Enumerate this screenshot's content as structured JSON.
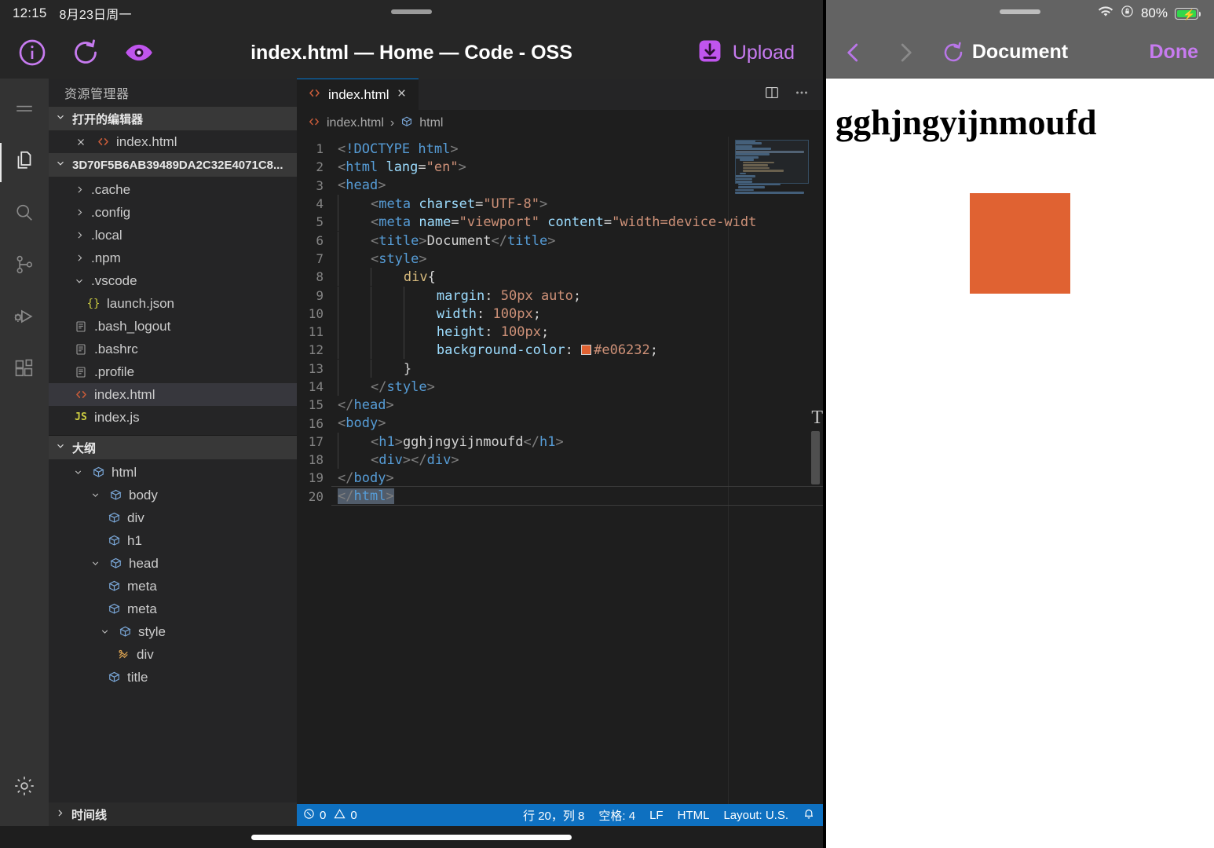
{
  "ios_status_left": {
    "time": "12:15",
    "date": "8月23日周一"
  },
  "ios_status_right": {
    "battery_percent": "80%",
    "wifi_icon": "wifi-icon",
    "lock_icon": "rotation-lock-icon",
    "battery_icon": "battery-charging-icon"
  },
  "app_toolbar": {
    "info_icon": "info-circle-icon",
    "refresh_icon": "refresh-icon",
    "preview_icon": "eye-icon",
    "title": "index.html — Home — Code - OSS",
    "upload_icon": "upload-icon",
    "upload_label": "Upload",
    "accent": "#c77bf0"
  },
  "activity_bar": {
    "items": [
      {
        "name": "menu",
        "icon": "hamburger-menu-icon",
        "active": false
      },
      {
        "name": "explorer",
        "icon": "files-icon",
        "active": true
      },
      {
        "name": "search",
        "icon": "search-icon",
        "active": false
      },
      {
        "name": "source-control",
        "icon": "source-control-icon",
        "active": false
      },
      {
        "name": "run-debug",
        "icon": "run-and-debug-icon",
        "active": false
      },
      {
        "name": "extensions",
        "icon": "extensions-icon",
        "active": false
      }
    ],
    "settings_icon": "gear-icon"
  },
  "sidebar": {
    "title": "资源管理器",
    "open_editors": {
      "label": "打开的编辑器",
      "chevron": "chevron-down-icon",
      "items": [
        {
          "close": "close-icon",
          "icon": "html-file-icon",
          "label": "index.html"
        }
      ]
    },
    "folder": {
      "label": "3D70F5B6AB39489DA2C32E4071C8...",
      "chevron": "chevron-down-icon",
      "items": [
        {
          "chevron": "chevron-right-icon",
          "icon": "",
          "label": ".cache",
          "selected": false
        },
        {
          "chevron": "chevron-right-icon",
          "icon": "",
          "label": ".config",
          "selected": false
        },
        {
          "chevron": "chevron-right-icon",
          "icon": "",
          "label": ".local",
          "selected": false
        },
        {
          "chevron": "chevron-right-icon",
          "icon": "",
          "label": ".npm",
          "selected": false
        },
        {
          "chevron": "chevron-down-icon",
          "icon": "",
          "label": ".vscode",
          "selected": false
        },
        {
          "chevron": "",
          "icon": "json-file-icon",
          "label": "launch.json",
          "selected": false
        },
        {
          "chevron": "",
          "icon": "text-file-icon",
          "label": ".bash_logout",
          "selected": false
        },
        {
          "chevron": "",
          "icon": "text-file-icon",
          "label": ".bashrc",
          "selected": false
        },
        {
          "chevron": "",
          "icon": "text-file-icon",
          "label": ".profile",
          "selected": false
        },
        {
          "chevron": "",
          "icon": "html-file-icon",
          "label": "index.html",
          "selected": true
        },
        {
          "chevron": "",
          "icon": "js-file-icon",
          "label": "index.js",
          "selected": false
        }
      ]
    },
    "outline": {
      "label": "大纲",
      "chevron": "chevron-down-icon",
      "items": [
        {
          "depth": 0,
          "chevron": "chevron-down-icon",
          "icon": "symbol-field-icon",
          "label": "html"
        },
        {
          "depth": 1,
          "chevron": "chevron-down-icon",
          "icon": "symbol-field-icon",
          "label": "body"
        },
        {
          "depth": 2,
          "chevron": "",
          "icon": "symbol-field-icon",
          "label": "div"
        },
        {
          "depth": 2,
          "chevron": "",
          "icon": "symbol-field-icon",
          "label": "h1"
        },
        {
          "depth": 1,
          "chevron": "chevron-down-icon",
          "icon": "symbol-field-icon",
          "label": "head"
        },
        {
          "depth": 2,
          "chevron": "",
          "icon": "symbol-field-icon",
          "label": "meta"
        },
        {
          "depth": 2,
          "chevron": "",
          "icon": "symbol-field-icon",
          "label": "meta"
        },
        {
          "depth": 2,
          "chevron": "chevron-down-icon",
          "icon": "symbol-field-icon",
          "label": "style"
        },
        {
          "depth": 3,
          "chevron": "",
          "icon": "symbol-ruler-icon",
          "label": "div"
        },
        {
          "depth": 2,
          "chevron": "",
          "icon": "symbol-field-icon",
          "label": "title"
        }
      ]
    },
    "timeline": {
      "label": "时间线",
      "chevron": "chevron-right-icon"
    }
  },
  "editor": {
    "tab": {
      "icon": "html-file-icon",
      "label": "index.html",
      "close": "close-icon"
    },
    "actions": {
      "split": "split-editor-icon",
      "more": "more-actions-icon"
    },
    "breadcrumb": {
      "file_icon": "html-file-icon",
      "file": "index.html",
      "sep": "›",
      "sym_icon": "symbol-field-icon",
      "symbol": "html"
    },
    "code": [
      {
        "n": "1",
        "text": "<!DOCTYPE html>"
      },
      {
        "n": "2",
        "text": "<html lang=\"en\">"
      },
      {
        "n": "3",
        "text": "<head>"
      },
      {
        "n": "4",
        "text": "    <meta charset=\"UTF-8\">"
      },
      {
        "n": "5",
        "text": "    <meta name=\"viewport\" content=\"width=device-widt"
      },
      {
        "n": "6",
        "text": "    <title>Document</title>"
      },
      {
        "n": "7",
        "text": "    <style>"
      },
      {
        "n": "8",
        "text": "        div{"
      },
      {
        "n": "9",
        "text": "            margin: 50px auto;"
      },
      {
        "n": "10",
        "text": "            width: 100px;"
      },
      {
        "n": "11",
        "text": "            height: 100px;"
      },
      {
        "n": "12",
        "text": "            background-color: #e06232;"
      },
      {
        "n": "13",
        "text": "        }"
      },
      {
        "n": "14",
        "text": "    </style>"
      },
      {
        "n": "15",
        "text": "</head>"
      },
      {
        "n": "16",
        "text": "<body>"
      },
      {
        "n": "17",
        "text": "    <h1>gghjngyijnmoufd</h1>"
      },
      {
        "n": "18",
        "text": "    <div></div>"
      },
      {
        "n": "19",
        "text": "</body>"
      },
      {
        "n": "20",
        "text": "</html>"
      }
    ],
    "swatch_color": "#e06232",
    "t_marker": "T"
  },
  "status_bar": {
    "error_icon": "error-icon",
    "errors": "0",
    "warning_icon": "warning-icon",
    "warnings": "0",
    "cursor": "行 20，列 8",
    "indent": "空格: 4",
    "eol": "LF",
    "language": "HTML",
    "layout": "Layout: U.S.",
    "bell_icon": "bell-icon",
    "bg": "#0e70c0"
  },
  "safari": {
    "back_icon": "chevron-left-icon",
    "forward_icon": "chevron-right-icon",
    "reload_icon": "refresh-icon",
    "title": "Document",
    "done_label": "Done",
    "accent": "#c77bf0"
  },
  "preview": {
    "heading": "gghjngyijnmoufd",
    "box_color": "#e06232"
  }
}
